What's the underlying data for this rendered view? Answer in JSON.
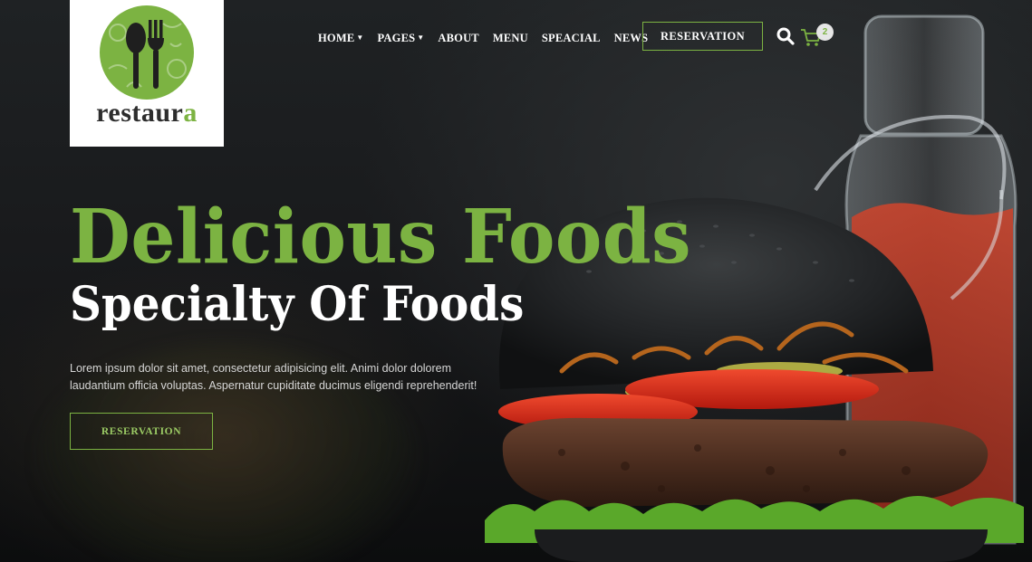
{
  "logo": {
    "text_main": "restaur",
    "text_accent": "a",
    "brand_color": "#7cb342"
  },
  "nav": {
    "items": [
      {
        "label": "HOME",
        "has_dropdown": true
      },
      {
        "label": "PAGES",
        "has_dropdown": true
      },
      {
        "label": "ABOUT",
        "has_dropdown": false
      },
      {
        "label": "MENU",
        "has_dropdown": false
      },
      {
        "label": "SPEACIAL",
        "has_dropdown": false
      },
      {
        "label": "NEWS",
        "has_dropdown": false
      }
    ],
    "reservation_label": "RESERVATION",
    "search_icon": "search-icon",
    "cart_icon": "cart-icon",
    "cart_count": "2"
  },
  "hero": {
    "title": "Delicious Foods",
    "subtitle": "Specialty Of Foods",
    "description_line1": "Lorem ipsum dolor sit amet, consectetur adipisicing elit. Animi dolor dolorem",
    "description_line2": "laudantium officia voluptas. Aspernatur cupiditate ducimus eligendi reprehenderit!",
    "button_label": "RESERVATION"
  },
  "colors": {
    "accent": "#7cb342",
    "text_light": "#ffffff",
    "background": "#141617"
  }
}
